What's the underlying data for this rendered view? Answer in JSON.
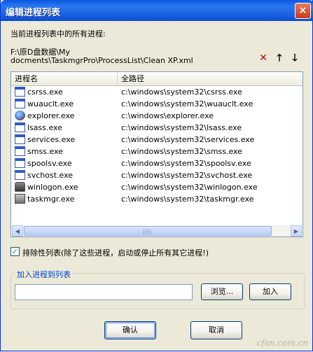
{
  "window": {
    "title": "编辑进程列表",
    "close_label": "×"
  },
  "header": {
    "label": "当前进程列表中的所有进程:",
    "path_line1": "F:\\原D盘数据\\My",
    "path_line2": "docments\\TaskmgrPro\\ProcessList\\Clean XP.xml"
  },
  "toolbar": {
    "delete_glyph": "✕",
    "up_glyph": "🡑",
    "down_glyph": "🡓"
  },
  "list": {
    "columns": [
      "进程名",
      "全路径"
    ],
    "rows": [
      {
        "name": "csrss.exe",
        "path": "c:\\windows\\system32\\csrss.exe",
        "icon": "window-app-icon"
      },
      {
        "name": "wuauclt.exe",
        "path": "c:\\windows\\system32\\wuauclt.exe",
        "icon": "window-app-icon"
      },
      {
        "name": "explorer.exe",
        "path": "c:\\windows\\explorer.exe",
        "icon": "explorer-icon"
      },
      {
        "name": "lsass.exe",
        "path": "c:\\windows\\system32\\lsass.exe",
        "icon": "window-app-icon"
      },
      {
        "name": "services.exe",
        "path": "c:\\windows\\system32\\services.exe",
        "icon": "window-app-icon"
      },
      {
        "name": "smss.exe",
        "path": "c:\\windows\\system32\\smss.exe",
        "icon": "window-app-icon"
      },
      {
        "name": "spoolsv.exe",
        "path": "c:\\windows\\system32\\spoolsv.exe",
        "icon": "window-app-icon"
      },
      {
        "name": "svchost.exe",
        "path": "c:\\windows\\system32\\svchost.exe",
        "icon": "window-app-icon"
      },
      {
        "name": "winlogon.exe",
        "path": "c:\\windows\\system32\\winlogon.exe",
        "icon": "lock-icon"
      },
      {
        "name": "taskmgr.exe",
        "path": "c:\\windows\\system32\\taskmgr.exe",
        "icon": "computer-icon"
      }
    ]
  },
  "options": {
    "exclusion_label": "排除性列表(除了这些进程，启动或停止所有其它进程!)",
    "exclusion_checked": true
  },
  "add_group": {
    "title": "加入进程到列表",
    "input_value": "",
    "browse_label": "浏览...",
    "add_label": "加入"
  },
  "footer": {
    "ok_label": "确认",
    "cancel_label": "取消"
  },
  "watermark": "cfan.com.cn",
  "colors": {
    "titlebar": "#1b60e0",
    "border": "#0831d9",
    "group_title": "#0046d5",
    "delete": "#c00000"
  }
}
